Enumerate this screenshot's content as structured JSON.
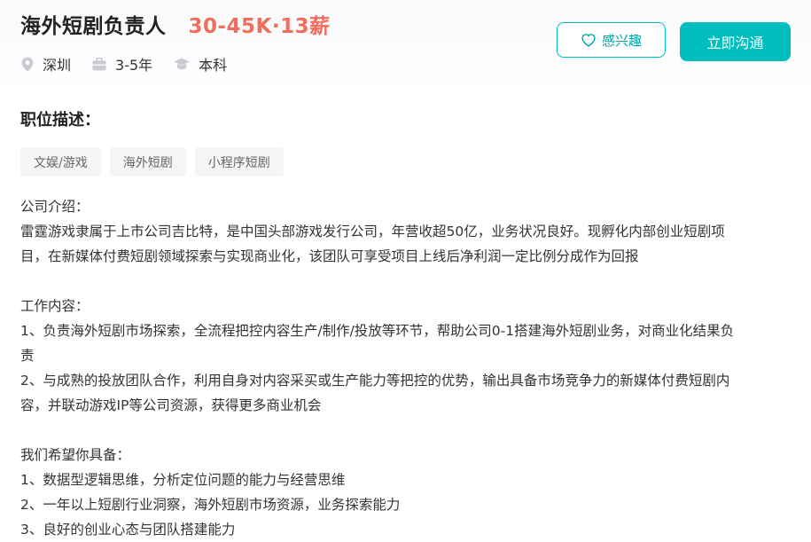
{
  "job": {
    "title": "海外短剧负责人",
    "salary": "30-45K·13薪"
  },
  "meta": {
    "location": "深圳",
    "experience": "3-5年",
    "education": "本科"
  },
  "actions": {
    "interest_label": "感兴趣",
    "apply_label": "立即沟通"
  },
  "description": {
    "section_title": "职位描述：",
    "tags": [
      "文娱/游戏",
      "海外短剧",
      "小程序短剧"
    ],
    "company_heading": "公司介绍：",
    "company_line1": "雷霆游戏隶属于上市公司吉比特，是中国头部游戏发行公司，年营收超50亿，业务状况良好。现孵化内部创业短剧项",
    "company_line2": "目，在新媒体付费短剧领域探索与实现商业化，该团队可享受项目上线后净利润一定比例分成作为回报",
    "work_heading": "工作内容：",
    "work_1_line1": "1、负责海外短剧市场探索，全流程把控内容生产/制作/投放等环节，帮助公司0-1搭建海外短剧业务，对商业化结果负",
    "work_1_line2": "责",
    "work_2_line1": "2、与成熟的投放团队合作，利用自身对内容采买或生产能力等把控的优势，输出具备市场竞争力的新媒体付费短剧内",
    "work_2_line2": "容，并联动游戏IP等公司资源，获得更多商业机会",
    "req_heading": "我们希望你具备：",
    "req_1": "1、数据型逻辑思维，分析定位问题的能力与经营思维",
    "req_2": "2、一年以上短剧行业洞察，海外短剧市场资源，业务探索能力",
    "req_3": "3、良好的创业心态与团队搭建能力"
  },
  "colors": {
    "accent": "#00bebd",
    "salary": "#f26d5b",
    "tag_bg": "#f3f5f7"
  },
  "icons": {
    "location": "location-pin-icon",
    "experience": "briefcase-icon",
    "education": "graduation-cap-icon",
    "interest": "heart-icon"
  }
}
